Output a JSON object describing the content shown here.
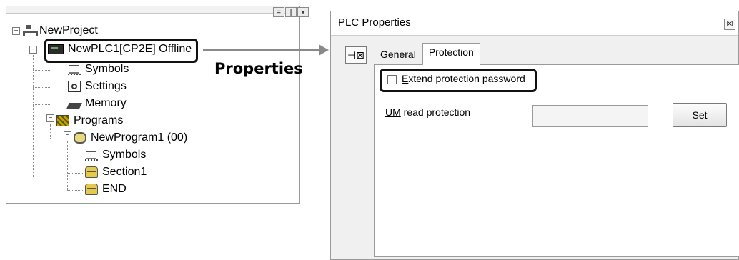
{
  "tree": {
    "scroll_buttons": [
      "=",
      "|",
      "x"
    ],
    "items": [
      {
        "label": "NewProject",
        "icon": "network-icon"
      },
      {
        "label": "NewPLC1[CP2E] Offline",
        "icon": "plc-icon"
      },
      {
        "label": "Symbols",
        "icon": "symbols-icon"
      },
      {
        "label": "Settings",
        "icon": "settings-icon"
      },
      {
        "label": "Memory",
        "icon": "memory-icon"
      },
      {
        "label": "Programs",
        "icon": "programs-icon"
      },
      {
        "label": "NewProgram1 (00)",
        "icon": "program-icon"
      },
      {
        "label": "Symbols",
        "icon": "symbols-icon"
      },
      {
        "label": "Section1",
        "icon": "section-icon"
      },
      {
        "label": "END",
        "icon": "section-icon"
      }
    ]
  },
  "annotation": {
    "properties_label": "Properties"
  },
  "dialog": {
    "title": "PLC Properties",
    "close_glyph": "☒",
    "pin_glyph": "⊣⊠",
    "tabs": [
      {
        "label": "General",
        "active": false
      },
      {
        "label": "Protection",
        "active": true
      }
    ],
    "protection": {
      "extend_password_label_first": "E",
      "extend_password_label_rest": "xtend protection password",
      "extend_password_checked": false,
      "um_read_label_first": "UM",
      "um_read_label_rest": " read protection",
      "um_read_value": "",
      "set_button": "Set"
    }
  }
}
